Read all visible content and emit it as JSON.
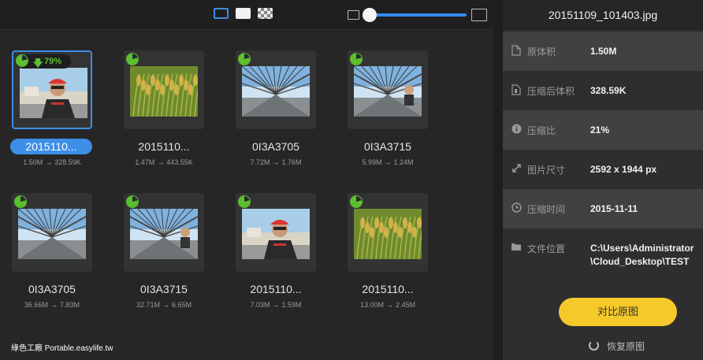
{
  "toolbar": {
    "view_modes": [
      "single-view-icon",
      "full-view-icon",
      "compare-view-icon"
    ],
    "zoom_small_icon": "image-small-icon",
    "zoom_large_icon": "image-large-icon",
    "zoom_level": 0.05
  },
  "images": [
    {
      "name": "20151109_101403.jpg",
      "label": "2015110...",
      "original": "1.50M",
      "compressed": "328.59K",
      "percent": "79%",
      "selected": true,
      "photo": "cyclist"
    },
    {
      "name": "rice",
      "label": "2015110...",
      "original": "1.47M",
      "compressed": "443.55K",
      "photo": "rice"
    },
    {
      "name": "0I3A3705",
      "label": "0I3A3705",
      "original": "7.72M",
      "compressed": "1.76M",
      "photo": "bridge"
    },
    {
      "name": "0I3A3715",
      "label": "0I3A3715",
      "original": "5.99M",
      "compressed": "1.24M",
      "photo": "bridge2"
    },
    {
      "name": "0I3A3705",
      "label": "0I3A3705",
      "original": "36.66M",
      "compressed": "7.83M",
      "photo": "bridge"
    },
    {
      "name": "0I3A3715",
      "label": "0I3A3715",
      "original": "32.71M",
      "compressed": "6.65M",
      "photo": "bridge2"
    },
    {
      "name": "cyclist",
      "label": "2015110...",
      "original": "7.03M",
      "compressed": "1.59M",
      "photo": "cyclist"
    },
    {
      "name": "rice",
      "label": "2015110...",
      "original": "13.00M",
      "compressed": "2.45M",
      "photo": "rice"
    }
  ],
  "size_arrow": "→",
  "detail": {
    "title": "20151109_101403.jpg",
    "rows": [
      {
        "icon": "file-icon",
        "label": "原体积",
        "value": "1.50M"
      },
      {
        "icon": "compressed-file-icon",
        "label": "压缩后体积",
        "value": "328.59K"
      },
      {
        "icon": "info-icon",
        "label": "压缩比",
        "value": "21%"
      },
      {
        "icon": "resize-icon",
        "label": "图片尺寸",
        "value": "2592 x 1944 px"
      },
      {
        "icon": "clock-icon",
        "label": "压缩时间",
        "value": "2015-11-11"
      },
      {
        "icon": "folder-icon",
        "label": "文件位置",
        "value": "C:\\Users\\Administrator\\Cloud_Desktop\\TEST"
      }
    ],
    "compare_button": "对比原图",
    "restore_button": "恢复原图"
  },
  "watermark": "綠色工廠 Portable.easylife.tw",
  "colors": {
    "accent": "#3d8ee6",
    "progress": "#5bbf2f",
    "button": "#f5c92a"
  }
}
